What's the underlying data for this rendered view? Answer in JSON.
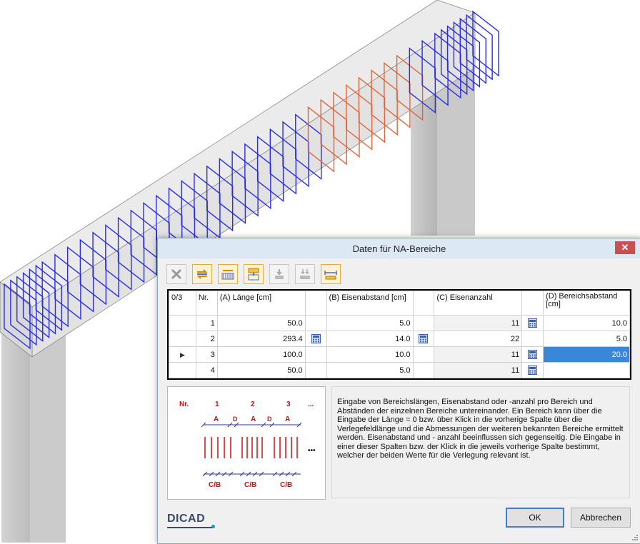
{
  "dialog": {
    "title": "Daten für NA-Bereiche",
    "close_glyph": "✕",
    "toolbar": [
      {
        "name": "delete-row-icon",
        "label": ""
      },
      {
        "name": "swap-direction-icon",
        "label": ""
      },
      {
        "name": "distribute-icon",
        "label": ""
      },
      {
        "name": "insert-row-icon",
        "label": ""
      },
      {
        "name": "move-down-icon",
        "label": ""
      },
      {
        "name": "move-bottom-icon",
        "label": ""
      },
      {
        "name": "measure-length-icon",
        "label": ""
      }
    ],
    "grid": {
      "corner": "0/3",
      "columns": {
        "nr": "Nr.",
        "a": "(A) Länge [cm]",
        "b": "(B) Eisenabstand [cm]",
        "c": "(C) Eisenanzahl",
        "d": "(D) Bereichsabstand [cm]"
      },
      "rows": [
        {
          "nr": "1",
          "a": "50.0",
          "b": "5.0",
          "c": "11",
          "d": "10.0",
          "a_calc": false,
          "b_calc": false,
          "c_calc": true
        },
        {
          "nr": "2",
          "a": "293.4",
          "b": "14.0",
          "c": "22",
          "d": "5.0",
          "a_calc": true,
          "b_calc": true,
          "c_calc": false
        },
        {
          "nr": "3",
          "a": "100.0",
          "b": "10.0",
          "c": "11",
          "d": "20.0",
          "a_calc": false,
          "b_calc": false,
          "c_calc": true,
          "current": true
        },
        {
          "nr": "4",
          "a": "50.0",
          "b": "5.0",
          "c": "11",
          "d": "",
          "a_calc": false,
          "b_calc": false,
          "c_calc": true
        }
      ]
    },
    "sketch": {
      "nr": "Nr.",
      "numbers": [
        "1",
        "2",
        "3"
      ],
      "ellipsis": "...",
      "a": "A",
      "d": "D",
      "cb": "C/B",
      "dots": "•••"
    },
    "description": "Eingabe von Bereichslängen, Eisenabstand oder -anzahl pro Bereich und Abständen der einzelnen Bereiche untereinander. Ein Bereich kann über die Eingabe der Länge = 0 bzw. über Klick in die vorherige Spalte über die Verlegefeldlänge und die Abmessungen der weiteren bekannten Bereiche ermittelt werden. Eisenabstand und - anzahl beeinflussen sich gegenseitig. Die Eingabe in einer dieser Spalten bzw. der Klick in die jeweils vorherige Spalte bestimmt, welcher der beiden Werte für die Verlegung relevant ist.",
    "logo": "DICAD",
    "buttons": {
      "ok": "OK",
      "cancel": "Abbrechen"
    }
  },
  "colors": {
    "stirrup": "#2a2ee0",
    "stirrup_highlight": "#e0653a",
    "beam": "#e6e6e6",
    "selection": "#3a86d8"
  }
}
